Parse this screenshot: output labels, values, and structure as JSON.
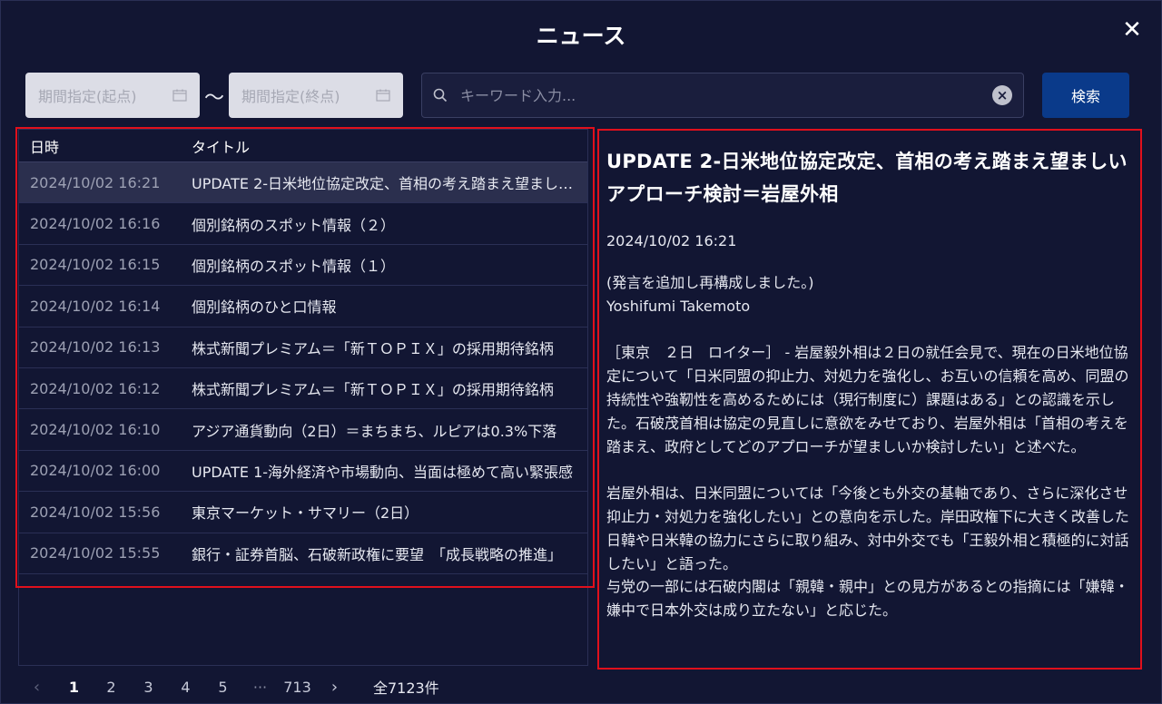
{
  "header": {
    "title": "ニュース",
    "close_glyph": "✕"
  },
  "filters": {
    "start_placeholder": "期間指定(起点)",
    "end_placeholder": "期間指定(終点)",
    "range_separator": "～",
    "search_placeholder": "キーワード入力...",
    "search_value": "",
    "search_button": "検索"
  },
  "list": {
    "columns": {
      "date": "日時",
      "title": "タイトル"
    },
    "rows": [
      {
        "date": "2024/10/02 16:21",
        "title": "UPDATE 2-日米地位協定改定、首相の考え踏まえ望ましいアプローチ検討＝岩屋外相",
        "selected": true
      },
      {
        "date": "2024/10/02 16:16",
        "title": "個別銘柄のスポット情報（２）"
      },
      {
        "date": "2024/10/02 16:15",
        "title": "個別銘柄のスポット情報（１）"
      },
      {
        "date": "2024/10/02 16:14",
        "title": "個別銘柄のひと口情報"
      },
      {
        "date": "2024/10/02 16:13",
        "title": "株式新聞プレミアム＝「新ＴＯＰＩＸ」の採用期待銘柄"
      },
      {
        "date": "2024/10/02 16:12",
        "title": "株式新聞プレミアム＝「新ＴＯＰＩＸ」の採用期待銘柄"
      },
      {
        "date": "2024/10/02 16:10",
        "title": "アジア通貨動向（2日）＝まちまち、ルピアは0.3%下落"
      },
      {
        "date": "2024/10/02 16:00",
        "title": "UPDATE 1-海外経済や市場動向、当面は極めて高い緊張感"
      },
      {
        "date": "2024/10/02 15:56",
        "title": "東京マーケット・サマリー（2日）"
      },
      {
        "date": "2024/10/02 15:55",
        "title": "銀行・証券首脳、石破新政権に要望　「成長戦略の推進」"
      }
    ]
  },
  "detail": {
    "title": "UPDATE 2-日米地位協定改定、首相の考え踏まえ望ましいアプローチ検討＝岩屋外相",
    "date": "2024/10/02 16:21",
    "body": "(発言を追加し再構成しました。)\nYoshifumi Takemoto\n\n［東京　２日　ロイター］ - 岩屋毅外相は２日の就任会見で、現在の日米地位協定について「日米同盟の抑止力、対処力を強化し、お互いの信頼を高め、同盟の持続性や強靭性を高めるためには（現行制度に）課題はある」との認識を示した。石破茂首相は協定の見直しに意欲をみせており、岩屋外相は「首相の考えを踏まえ、政府としてどのアプローチが望ましいか検討したい」と述べた。\n\n岩屋外相は、日米同盟については「今後とも外交の基軸であり、さらに深化させ抑止力・対処力を強化したい」との意向を示した。岸田政権下に大きく改善した日韓や日米韓の協力にさらに取り組み、対中外交でも「王毅外相と積極的に対話したい」と語った。\n与党の一部には石破内閣は「親韓・親中」との見方があるとの指摘には「嫌韓・嫌中で日本外交は成り立たない」と応じた。"
  },
  "pagination": {
    "prev": "‹",
    "next": "›",
    "pages": [
      "1",
      "2",
      "3",
      "4",
      "5"
    ],
    "ellipsis": "···",
    "last": "713",
    "current": "1",
    "total": "全7123件"
  },
  "colors": {
    "background": "#121633",
    "primary_button": "#0a3a8a",
    "highlight_border": "#e0101c",
    "selected_row": "#2b2f4e"
  },
  "icons": [
    "calendar-icon",
    "search-icon",
    "clear-icon",
    "close-icon",
    "chevron-left-icon",
    "chevron-right-icon"
  ]
}
